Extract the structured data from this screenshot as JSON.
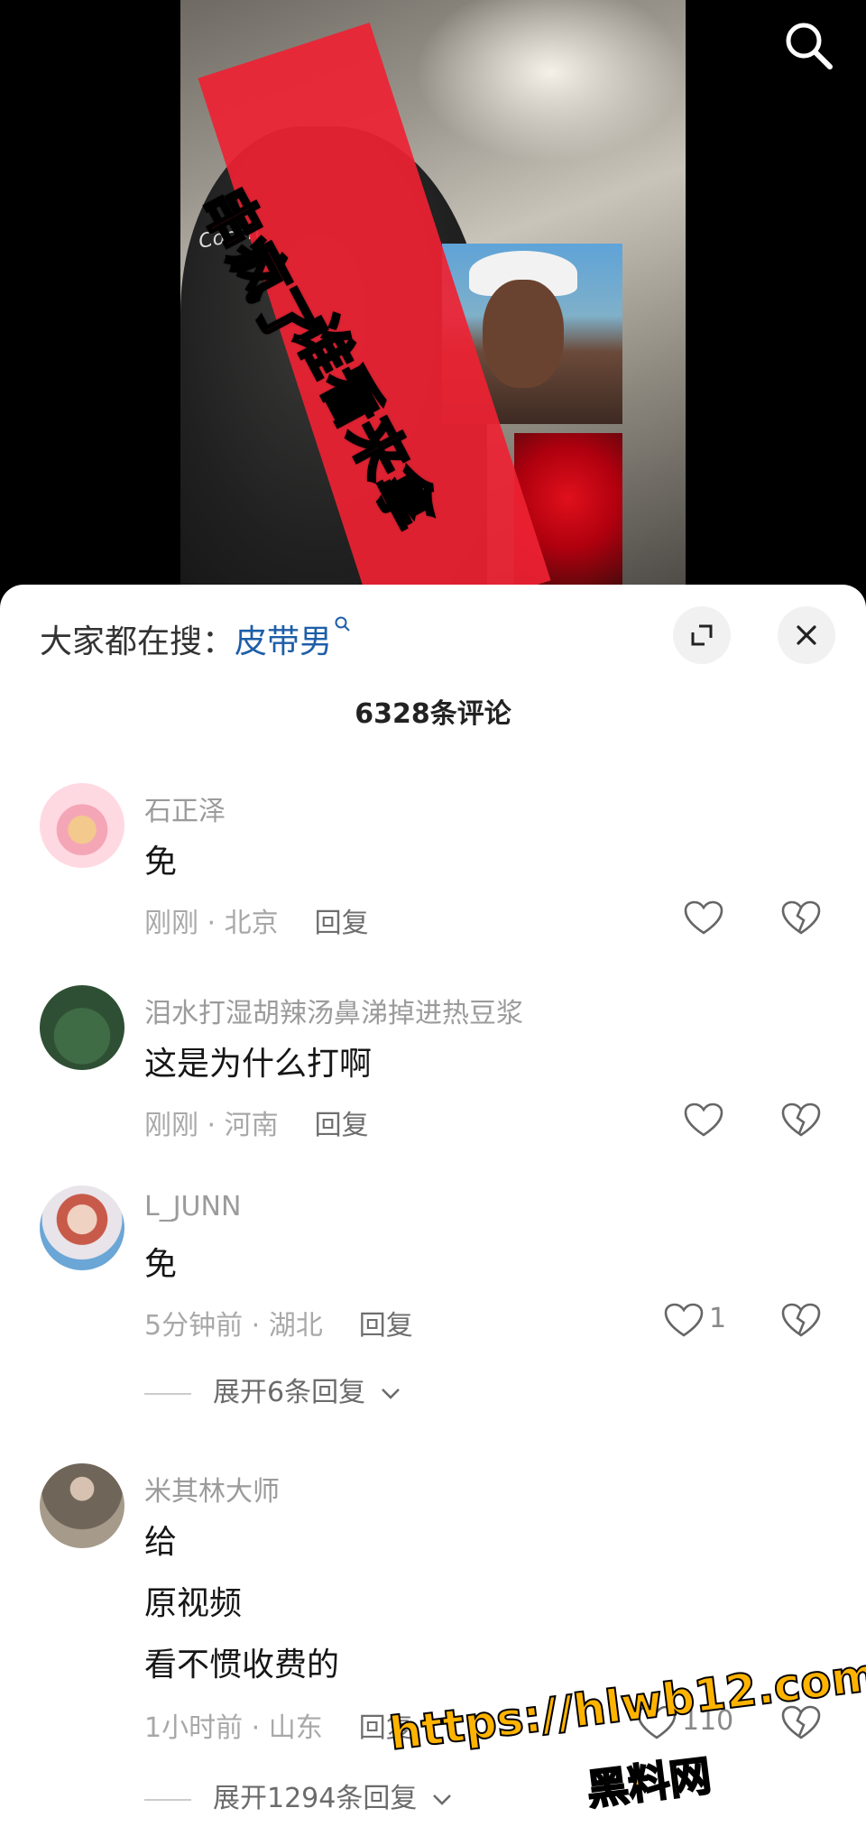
{
  "video": {
    "overlay_line1": "串疯了",
    "overlay_line2": "谁看来拿",
    "cap_text": "Cocon"
  },
  "search_bar": {
    "prefix": "大家都在搜：",
    "keyword": "皮带男",
    "search_icon": "magnifier-icon"
  },
  "header": {
    "comment_count": "6328条评论",
    "expand_icon": "expand-icon",
    "close_icon": "close-icon"
  },
  "comments": [
    {
      "user": "石正泽",
      "text": [
        "免"
      ],
      "time": "刚刚",
      "location": "北京",
      "reply": "回复",
      "likes": ""
    },
    {
      "user": "泪水打湿胡辣汤鼻涕掉进热豆浆",
      "text": [
        "这是为什么打啊"
      ],
      "time": "刚刚",
      "location": "河南",
      "reply": "回复",
      "likes": ""
    },
    {
      "user": "L_JUNN",
      "text": [
        "免"
      ],
      "time": "5分钟前",
      "location": "湖北",
      "reply": "回复",
      "likes": "1",
      "expand": "展开6条回复"
    },
    {
      "user": "米其林大师",
      "text": [
        "给",
        "原视频",
        "看不惯收费的"
      ],
      "time": "1小时前",
      "location": "山东",
      "reply": "回复",
      "likes": "110",
      "expand": "展开1294条回复"
    }
  ],
  "watermark": {
    "url": "https://hlwb12.com",
    "name": "黑料网"
  },
  "colors": {
    "keyword": "#1d5ea8",
    "username": "#9b9b9b",
    "watermark": "#ffb300"
  }
}
